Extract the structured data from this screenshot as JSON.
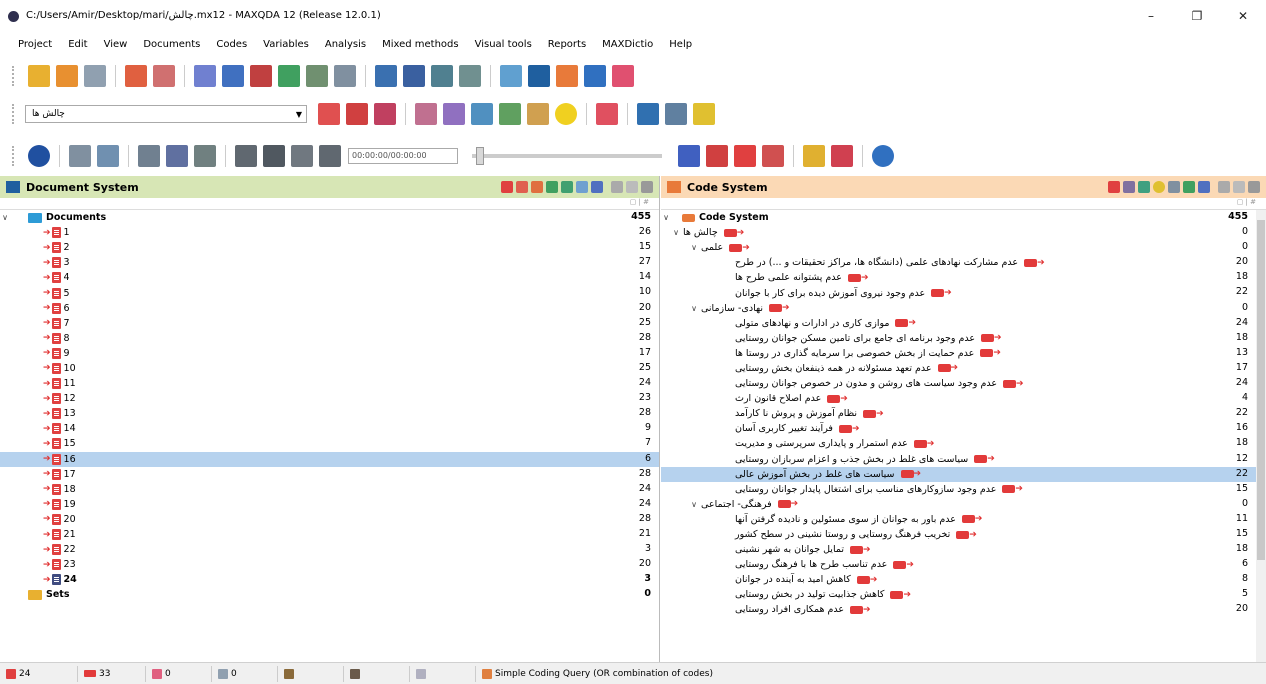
{
  "window": {
    "title": "C:/Users/Amir/Desktop/mari/چالش.mx12 - MAXQDA 12  (Release 12.0.1)",
    "minimize": "–",
    "maximize": "❐",
    "close": "✕"
  },
  "menu": [
    "Project",
    "Edit",
    "View",
    "Documents",
    "Codes",
    "Variables",
    "Analysis",
    "Mixed methods",
    "Visual tools",
    "Reports",
    "MAXDictio",
    "Help"
  ],
  "toolbar2": {
    "combo_value": "چالش ها"
  },
  "toolbar3": {
    "time": "00:00:00/00:00:00"
  },
  "doc_panel": {
    "title": "Document System",
    "root": {
      "label": "Documents",
      "count": "455"
    },
    "docs": [
      {
        "label": "1",
        "count": "26"
      },
      {
        "label": "2",
        "count": "15"
      },
      {
        "label": "3",
        "count": "27"
      },
      {
        "label": "4",
        "count": "14"
      },
      {
        "label": "5",
        "count": "10"
      },
      {
        "label": "6",
        "count": "20"
      },
      {
        "label": "7",
        "count": "25"
      },
      {
        "label": "8",
        "count": "28"
      },
      {
        "label": "9",
        "count": "17"
      },
      {
        "label": "10",
        "count": "25"
      },
      {
        "label": "11",
        "count": "24"
      },
      {
        "label": "12",
        "count": "23"
      },
      {
        "label": "13",
        "count": "28"
      },
      {
        "label": "14",
        "count": "9"
      },
      {
        "label": "15",
        "count": "7"
      },
      {
        "label": "16",
        "count": "6"
      },
      {
        "label": "17",
        "count": "28"
      },
      {
        "label": "18",
        "count": "24"
      },
      {
        "label": "19",
        "count": "24"
      },
      {
        "label": "20",
        "count": "28"
      },
      {
        "label": "21",
        "count": "21"
      },
      {
        "label": "22",
        "count": "3"
      },
      {
        "label": "23",
        "count": "20"
      },
      {
        "label": "24",
        "count": "3"
      }
    ],
    "sets": {
      "label": "Sets",
      "count": "0"
    }
  },
  "code_panel": {
    "title": "Code System",
    "root": {
      "label": "Code System",
      "count": "455"
    },
    "codes": [
      {
        "label": "چالش ها",
        "count": "0",
        "level": 1,
        "expander": "∨"
      },
      {
        "label": "علمی",
        "count": "0",
        "level": 2,
        "expander": "∨"
      },
      {
        "label": "عدم مشارکت نهادهای علمی (دانشگاه ها، مراکز تحقیقات و ...) در طرح",
        "count": "20",
        "level": 3
      },
      {
        "label": "عدم پشتوانه علمی طرح ها",
        "count": "18",
        "level": 3
      },
      {
        "label": "عدم وجود نیروی آموزش دیده برای کار با جوانان",
        "count": "22",
        "level": 3
      },
      {
        "label": "نهادی- سازمانی",
        "count": "0",
        "level": 2,
        "expander": "∨"
      },
      {
        "label": "موازی کاری در ادارات و نهادهای متولی",
        "count": "24",
        "level": 3
      },
      {
        "label": "عدم وجود برنامه ای جامع برای تامین مسکن جوانان روستایی",
        "count": "18",
        "level": 3
      },
      {
        "label": "عدم حمایت از بخش خصوصی برا سرمایه گذاری در روستا ها",
        "count": "13",
        "level": 3
      },
      {
        "label": "عدم تعهد مسئولانه در همه ذینفعان بخش روستایی",
        "count": "17",
        "level": 3
      },
      {
        "label": "عدم وجود سیاست های روشن و مدون در خصوص جوانان روستایی",
        "count": "24",
        "level": 3
      },
      {
        "label": "عدم اصلاح قانون ارث",
        "count": "4",
        "level": 3
      },
      {
        "label": "نظام آموزش و پروش نا کارآمد",
        "count": "22",
        "level": 3
      },
      {
        "label": "فرآیند تغییر کاربری آسان",
        "count": "16",
        "level": 3
      },
      {
        "label": "عدم استمرار و پایداری سرپرستی و مدیریت",
        "count": "18",
        "level": 3
      },
      {
        "label": "سیاست های غلط در بخش جذب و اعزام سربازان روستایی",
        "count": "12",
        "level": 3
      },
      {
        "label": "سیاست های غلط در بخش آموزش عالی",
        "count": "22",
        "level": 3,
        "selected": true
      },
      {
        "label": "عدم وجود سازوکارهای مناسب برای اشتغال پایدار جوانان روستایی",
        "count": "15",
        "level": 3
      },
      {
        "label": "فرهنگی- اجتماعی",
        "count": "0",
        "level": 2,
        "expander": "∨"
      },
      {
        "label": "عدم باور به جوانان از سوی مسئولین و نادیده گرفتن آنها",
        "count": "11",
        "level": 3
      },
      {
        "label": "تخریب فرهنگ روستایی و روستا نشینی در سطح کشور",
        "count": "15",
        "level": 3
      },
      {
        "label": "تمایل جوانان به شهر نشینی",
        "count": "18",
        "level": 3
      },
      {
        "label": "عدم تناسب طرح ها با فرهنگ روستایی",
        "count": "6",
        "level": 3
      },
      {
        "label": "کاهش امید به آینده در جوانان",
        "count": "8",
        "level": 3
      },
      {
        "label": "کاهش جذابیت تولید در بخش روستایی",
        "count": "5",
        "level": 3
      },
      {
        "label": "عدم همکاری افراد روستایی",
        "count": "20",
        "level": 3
      }
    ]
  },
  "status": {
    "docs": "24",
    "codes": "33",
    "memos1": "0",
    "memos2": "0",
    "query": "Simple Coding Query (OR combination of codes)"
  }
}
